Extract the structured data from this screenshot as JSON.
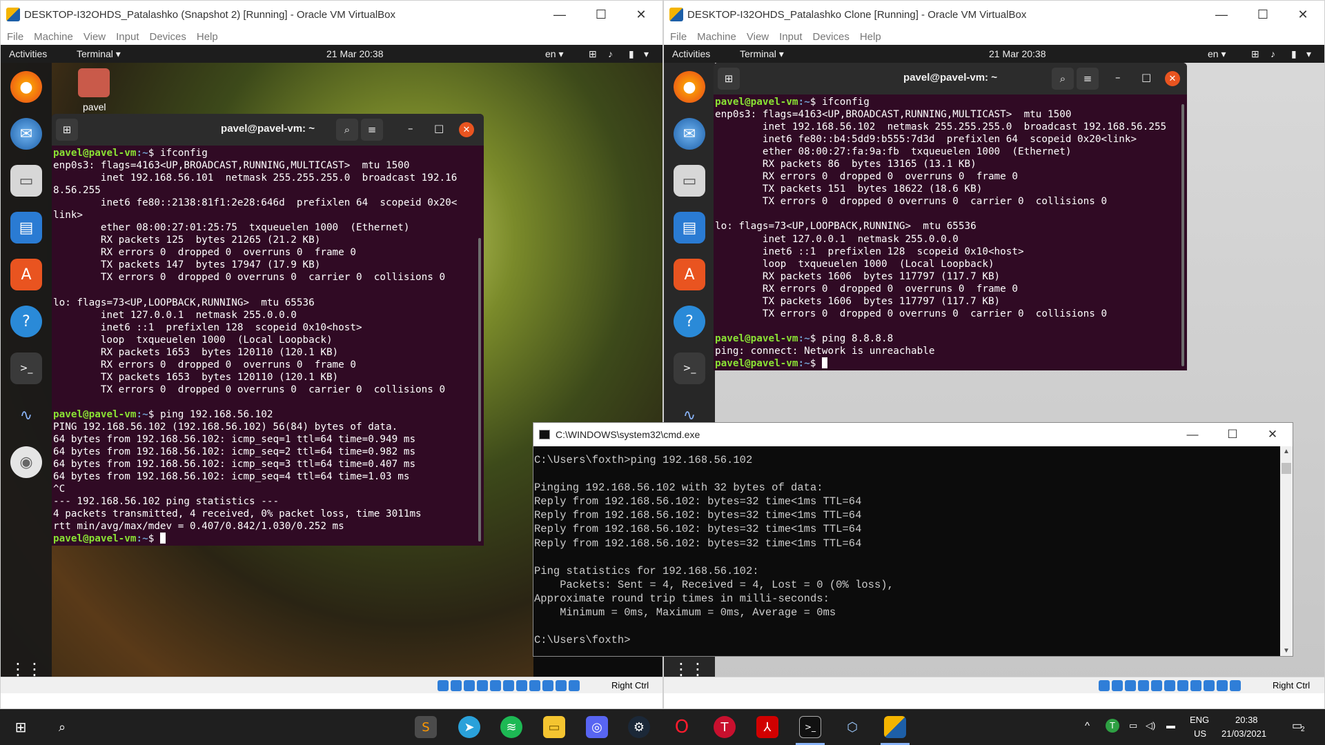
{
  "vm_left": {
    "window_title": "DESKTOP-I32OHDS_Patalashko (Snapshot 2) [Running] - Oracle VM VirtualBox",
    "menu": [
      "File",
      "Machine",
      "View",
      "Input",
      "Devices",
      "Help"
    ],
    "topbar": {
      "activities": "Activities",
      "app": "Terminal ▾",
      "clock": "21 Mar  20:38",
      "lang": "en ▾"
    },
    "desktop_icon_label": "pavel",
    "terminal": {
      "title": "pavel@pavel-vm: ~",
      "lines": [
        {
          "p": "pavel@pavel-vm",
          "path": ":~",
          "t": "$ ifconfig"
        },
        {
          "t": "enp0s3: flags=4163<UP,BROADCAST,RUNNING,MULTICAST>  mtu 1500"
        },
        {
          "t": "        inet 192.168.56.101  netmask 255.255.255.0  broadcast 192.16"
        },
        {
          "t": "8.56.255"
        },
        {
          "t": "        inet6 fe80::2138:81f1:2e28:646d  prefixlen 64  scopeid 0x20<"
        },
        {
          "t": "link>"
        },
        {
          "t": "        ether 08:00:27:01:25:75  txqueuelen 1000  (Ethernet)"
        },
        {
          "t": "        RX packets 125  bytes 21265 (21.2 KB)"
        },
        {
          "t": "        RX errors 0  dropped 0  overruns 0  frame 0"
        },
        {
          "t": "        TX packets 147  bytes 17947 (17.9 KB)"
        },
        {
          "t": "        TX errors 0  dropped 0 overruns 0  carrier 0  collisions 0"
        },
        {
          "t": ""
        },
        {
          "t": "lo: flags=73<UP,LOOPBACK,RUNNING>  mtu 65536"
        },
        {
          "t": "        inet 127.0.0.1  netmask 255.0.0.0"
        },
        {
          "t": "        inet6 ::1  prefixlen 128  scopeid 0x10<host>"
        },
        {
          "t": "        loop  txqueuelen 1000  (Local Loopback)"
        },
        {
          "t": "        RX packets 1653  bytes 120110 (120.1 KB)"
        },
        {
          "t": "        RX errors 0  dropped 0  overruns 0  frame 0"
        },
        {
          "t": "        TX packets 1653  bytes 120110 (120.1 KB)"
        },
        {
          "t": "        TX errors 0  dropped 0 overruns 0  carrier 0  collisions 0"
        },
        {
          "t": ""
        },
        {
          "p": "pavel@pavel-vm",
          "path": ":~",
          "t": "$ ping 192.168.56.102"
        },
        {
          "t": "PING 192.168.56.102 (192.168.56.102) 56(84) bytes of data."
        },
        {
          "t": "64 bytes from 192.168.56.102: icmp_seq=1 ttl=64 time=0.949 ms"
        },
        {
          "t": "64 bytes from 192.168.56.102: icmp_seq=2 ttl=64 time=0.982 ms"
        },
        {
          "t": "64 bytes from 192.168.56.102: icmp_seq=3 ttl=64 time=0.407 ms"
        },
        {
          "t": "64 bytes from 192.168.56.102: icmp_seq=4 ttl=64 time=1.03 ms"
        },
        {
          "t": "^C"
        },
        {
          "t": "--- 192.168.56.102 ping statistics ---"
        },
        {
          "t": "4 packets transmitted, 4 received, 0% packet loss, time 3011ms"
        },
        {
          "t": "rtt min/avg/max/mdev = 0.407/0.842/1.030/0.252 ms"
        },
        {
          "p": "pavel@pavel-vm",
          "path": ":~",
          "t": "$ ",
          "cursor": true
        }
      ]
    },
    "statusbar_host_key": "Right Ctrl"
  },
  "vm_right": {
    "window_title": "DESKTOP-I32OHDS_Patalashko Clone [Running] - Oracle VM VirtualBox",
    "menu": [
      "File",
      "Machine",
      "View",
      "Input",
      "Devices",
      "Help"
    ],
    "topbar": {
      "activities": "Activities",
      "app": "Terminal ▾",
      "clock": "21 Mar  20:38",
      "lang": "en ▾"
    },
    "terminal": {
      "title": "pavel@pavel-vm: ~",
      "lines": [
        {
          "p": "pavel@pavel-vm",
          "path": ":~",
          "t": "$ ifconfig"
        },
        {
          "t": "enp0s3: flags=4163<UP,BROADCAST,RUNNING,MULTICAST>  mtu 1500"
        },
        {
          "t": "        inet 192.168.56.102  netmask 255.255.255.0  broadcast 192.168.56.255"
        },
        {
          "t": "        inet6 fe80::b4:5dd9:b555:7d3d  prefixlen 64  scopeid 0x20<link>"
        },
        {
          "t": "        ether 08:00:27:fa:9a:fb  txqueuelen 1000  (Ethernet)"
        },
        {
          "t": "        RX packets 86  bytes 13165 (13.1 KB)"
        },
        {
          "t": "        RX errors 0  dropped 0  overruns 0  frame 0"
        },
        {
          "t": "        TX packets 151  bytes 18622 (18.6 KB)"
        },
        {
          "t": "        TX errors 0  dropped 0 overruns 0  carrier 0  collisions 0"
        },
        {
          "t": ""
        },
        {
          "t": "lo: flags=73<UP,LOOPBACK,RUNNING>  mtu 65536"
        },
        {
          "t": "        inet 127.0.0.1  netmask 255.0.0.0"
        },
        {
          "t": "        inet6 ::1  prefixlen 128  scopeid 0x10<host>"
        },
        {
          "t": "        loop  txqueuelen 1000  (Local Loopback)"
        },
        {
          "t": "        RX packets 1606  bytes 117797 (117.7 KB)"
        },
        {
          "t": "        RX errors 0  dropped 0  overruns 0  frame 0"
        },
        {
          "t": "        TX packets 1606  bytes 117797 (117.7 KB)"
        },
        {
          "t": "        TX errors 0  dropped 0 overruns 0  carrier 0  collisions 0"
        },
        {
          "t": ""
        },
        {
          "p": "pavel@pavel-vm",
          "path": ":~",
          "t": "$ ping 8.8.8.8"
        },
        {
          "t": "ping: connect: Network is unreachable"
        },
        {
          "p": "pavel@pavel-vm",
          "path": ":~",
          "t": "$ ",
          "cursor": true
        }
      ]
    },
    "statusbar_host_key": "Right Ctrl"
  },
  "cmd": {
    "title": "C:\\WINDOWS\\system32\\cmd.exe",
    "lines": [
      "C:\\Users\\foxth>ping 192.168.56.102",
      "",
      "Pinging 192.168.56.102 with 32 bytes of data:",
      "Reply from 192.168.56.102: bytes=32 time<1ms TTL=64",
      "Reply from 192.168.56.102: bytes=32 time<1ms TTL=64",
      "Reply from 192.168.56.102: bytes=32 time<1ms TTL=64",
      "Reply from 192.168.56.102: bytes=32 time<1ms TTL=64",
      "",
      "Ping statistics for 192.168.56.102:",
      "    Packets: Sent = 4, Received = 4, Lost = 0 (0% loss),",
      "Approximate round trip times in milli-seconds:",
      "    Minimum = 0ms, Maximum = 0ms, Average = 0ms",
      "",
      "C:\\Users\\foxth>"
    ]
  },
  "taskbar": {
    "lang_top": "ENG",
    "lang_bottom": "US",
    "time": "20:38",
    "date": "21/03/2021",
    "notifications": "2",
    "pinned": [
      "sublime-text-icon",
      "telegram-icon",
      "spotify-icon",
      "file-explorer-icon",
      "discord-icon",
      "steam-icon",
      "opera-icon",
      "tunnelbear-icon",
      "acrobat-icon",
      "cmd-icon",
      "virtualbox-cube-icon",
      "virtualbox-icon"
    ]
  },
  "colors": {
    "terminal_bg": "#300a24",
    "prompt_user": "#8ae234",
    "prompt_path": "#729fcf",
    "ubuntu_orange": "#e95420"
  }
}
